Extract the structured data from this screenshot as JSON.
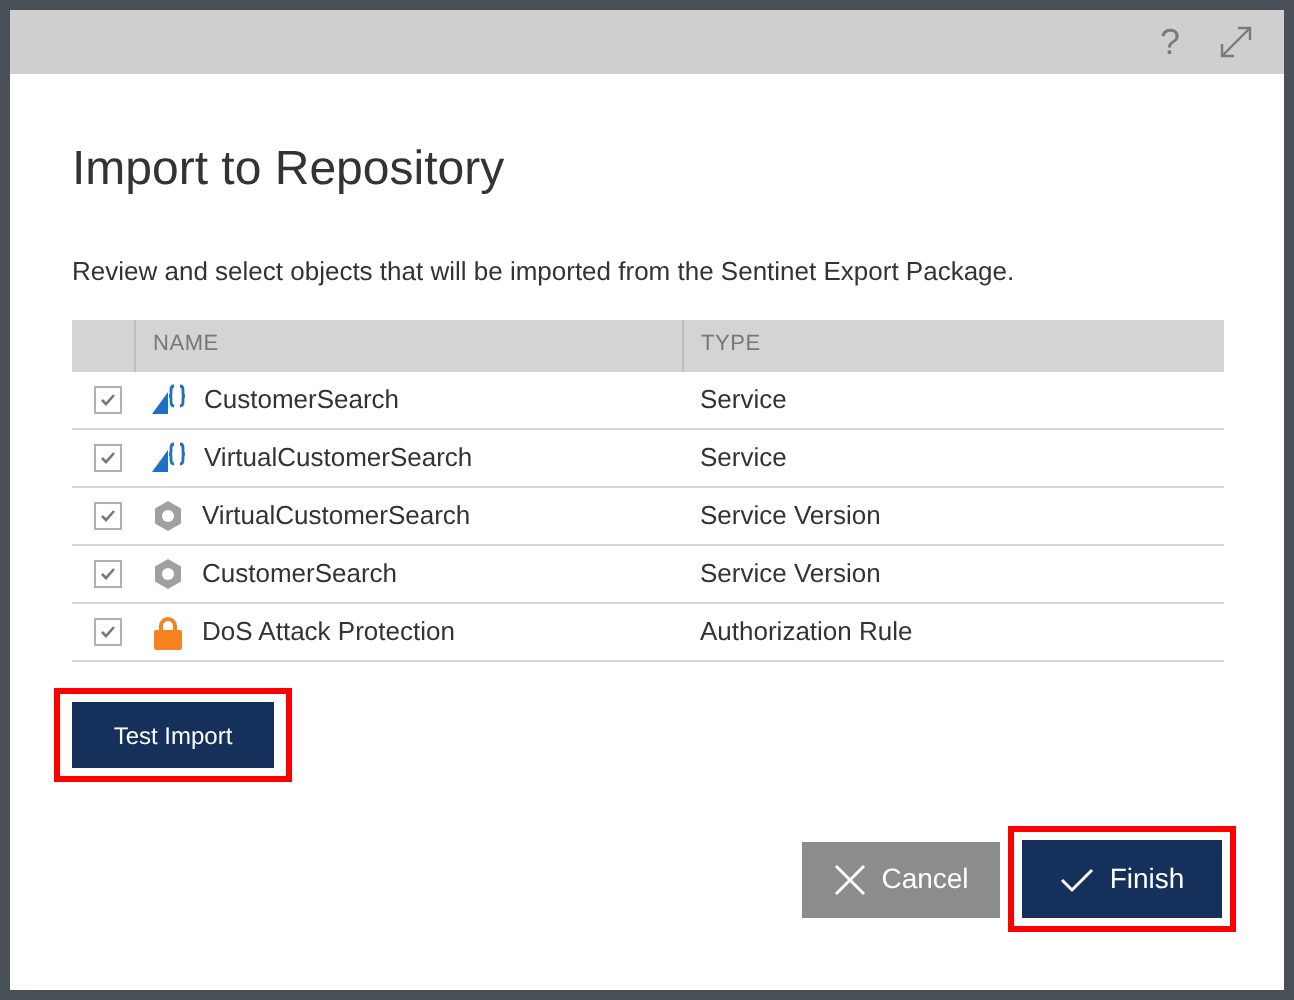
{
  "dialog": {
    "title": "Import to Repository",
    "description": "Review and select objects that will be imported from the Sentinet Export Package.",
    "help": "?"
  },
  "table": {
    "columns": [
      "NAME",
      "TYPE"
    ],
    "rows": [
      {
        "name": "CustomerSearch",
        "type": "Service",
        "kind": "service",
        "checked": true
      },
      {
        "name": "VirtualCustomerSearch",
        "type": "Service",
        "kind": "service",
        "checked": true
      },
      {
        "name": "VirtualCustomerSearch",
        "type": "Service Version",
        "kind": "version",
        "checked": true
      },
      {
        "name": "CustomerSearch",
        "type": "Service Version",
        "kind": "version",
        "checked": true
      },
      {
        "name": "DoS Attack Protection",
        "type": "Authorization Rule",
        "kind": "rule",
        "checked": true
      }
    ]
  },
  "buttons": {
    "test": "Test Import",
    "cancel": "Cancel",
    "finish": "Finish"
  }
}
